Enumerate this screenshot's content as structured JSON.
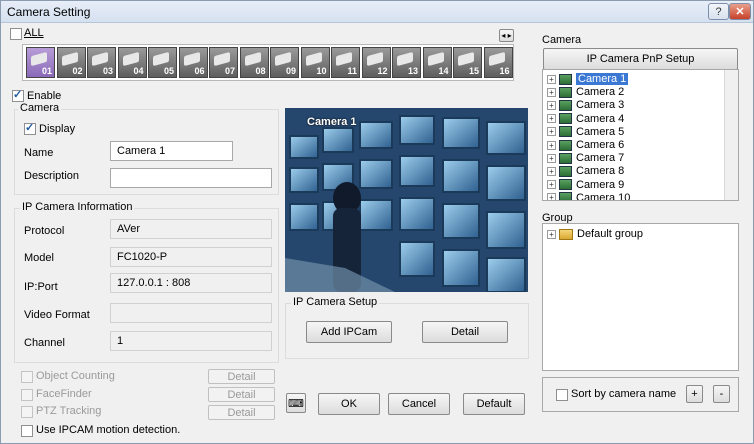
{
  "window": {
    "title": "Camera Setting",
    "help": "?",
    "close": "✕"
  },
  "top": {
    "all_label": "ALL",
    "nav_arrows": "◂ ▸"
  },
  "cameras_strip": [
    "01",
    "02",
    "03",
    "04",
    "05",
    "06",
    "07",
    "08",
    "09",
    "10",
    "11",
    "12",
    "13",
    "14",
    "15",
    "16"
  ],
  "enable": {
    "label": "Enable",
    "checked": true
  },
  "camera_group": {
    "title": "Camera",
    "display_label": "Display",
    "name_label": "Name",
    "name_value": "Camera 1",
    "description_label": "Description",
    "description_value": ""
  },
  "ip_info": {
    "title": "IP Camera Information",
    "protocol_label": "Protocol",
    "protocol_value": "AVer",
    "model_label": "Model",
    "model_value": "FC1020-P",
    "ipport_label": "IP:Port",
    "ipport_value": "127.0.0.1 : 808",
    "video_format_label": "Video Format",
    "video_format_value": "",
    "channel_label": "Channel",
    "channel_value": "1"
  },
  "preview": {
    "overlay": "Camera 1"
  },
  "ip_setup": {
    "title": "IP Camera Setup",
    "add_label": "Add IPCam",
    "detail_label": "Detail"
  },
  "features": {
    "object_counting": "Object Counting",
    "facefinder": "FaceFinder",
    "ptz_tracking": "PTZ Tracking",
    "detail": "Detail",
    "motion": "Use IPCAM motion detection."
  },
  "buttons": {
    "ok": "OK",
    "cancel": "Cancel",
    "default": "Default"
  },
  "right": {
    "camera_title": "Camera",
    "pnp_label": "IP Camera PnP Setup",
    "camera_list": [
      "Camera 1",
      "Camera 2",
      "Camera 3",
      "Camera 4",
      "Camera 5",
      "Camera 6",
      "Camera 7",
      "Camera 8",
      "Camera 9",
      "Camera 10"
    ],
    "group_title": "Group",
    "group_list": [
      "Default group"
    ],
    "sort_label": "Sort by camera name",
    "plus": "+",
    "minus": "-"
  }
}
